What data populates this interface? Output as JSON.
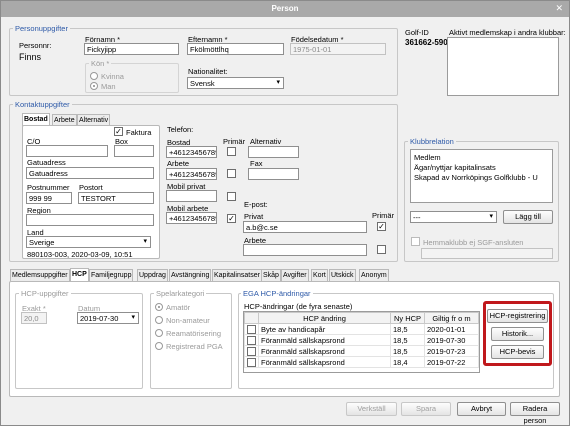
{
  "window": {
    "title": "Person"
  },
  "personuppgifter": {
    "title": "Personuppgifter",
    "personnr_label": "Personnr:",
    "personnr_value": "Finns",
    "fornamn_label": "Förnamn *",
    "fornamn_value": "Fickyjipp",
    "efternamn_label": "Efternamn *",
    "efternamn_value": "Fkölmöttlhq",
    "fodelsedatum_label": "Födelsedatum *",
    "fodelsedatum_value": "1975-01-01",
    "kon_label": "Kön *",
    "kon_options": [
      "Kvinna",
      "Man"
    ],
    "nationalitet_label": "Nationalitet:",
    "nationalitet_value": "Svensk",
    "golf_id_label": "Golf-ID",
    "golf_id_value": "361662-590",
    "aktivt_label": "Aktivt medlemskap i andra klubbar:"
  },
  "kontakt": {
    "title": "Kontaktuppgifter",
    "tabs": [
      "Bostad",
      "Arbete",
      "Alternativ"
    ],
    "faktura_label": "Faktura",
    "co_label": "C/O",
    "box_label": "Box",
    "gatuadress_label": "Gatuadress",
    "gatuadress_value": "Gatuadress",
    "postnummer_label": "Postnummer",
    "postnummer_value": "999 99",
    "postort_label": "Postort",
    "postort_value": "TESTORT",
    "region_label": "Region",
    "land_label": "Land",
    "land_value": "Sverige",
    "footer": "880103-003, 2020-03-09, 10:51",
    "telefon_label": "Telefon:",
    "primar_label": "Primär",
    "alternativ_label": "Alternativ",
    "bostad_label": "Bostad",
    "bostad_value": "+46123456789",
    "arbete_label": "Arbete",
    "arbete_value": "+46123456789",
    "fax_label": "Fax",
    "mobil_privat_label": "Mobil privat",
    "mobil_arbete_label": "Mobil arbete",
    "mobil_arbete_value": "+46123456789",
    "epost_label": "E-post:",
    "privat_label": "Privat",
    "privat_value": "a.b@c.se",
    "epost_primar_label": "Primär",
    "epost_arbete_label": "Arbete"
  },
  "klubbrelation": {
    "title": "Klubbrelation",
    "items": [
      "Medlem",
      "Ägar/nyttjar kapitalinsats",
      "Skapad av Norrköpings Golfklubb - U"
    ],
    "select_value": "---",
    "add_button": "Lägg till",
    "hemmaklubb_label": "Hemmaklubb ej SGF-ansluten"
  },
  "tabs": [
    "Medlemsuppgifter",
    "HCP",
    "Familjegrupp",
    "Uppdrag",
    "Avstängning",
    "Kapitalinsatser",
    "Skåp",
    "Avgifter",
    "Kort",
    "Utskick",
    "Anonym"
  ],
  "hcp_uppgifter": {
    "title": "HCP-uppgifter",
    "exakt_label": "Exakt *",
    "exakt_value": "20,0",
    "datum_label": "Datum",
    "datum_value": "2019-07-30"
  },
  "spelarkategori": {
    "title": "Spelarkategori",
    "options": [
      "Amatör",
      "Non-amateur",
      "Reamatörisering",
      "Registrerad PGA"
    ]
  },
  "ega": {
    "title": "EGA HCP-ändringar",
    "subtitle": "HCP-ändringar (de fyra senaste)",
    "columns": [
      "HCP ändring",
      "Ny HCP",
      "Giltig fr o m"
    ],
    "rows": [
      {
        "change": "Byte av handicapår",
        "hcp": "18,5",
        "date": "2020-01-01"
      },
      {
        "change": "Föranmäld sällskapsrond",
        "hcp": "18,5",
        "date": "2019-07-30"
      },
      {
        "change": "Föranmäld sällskapsrond",
        "hcp": "18,5",
        "date": "2019-07-23"
      },
      {
        "change": "Föranmäld sällskapsrond",
        "hcp": "18,4",
        "date": "2019-07-22"
      }
    ],
    "hcp_registrering": "HCP-registrering",
    "historik": "Historik...",
    "hcp_bevis": "HCP-bevis"
  },
  "footer": {
    "verkstall": "Verkställ",
    "spara": "Spara",
    "avbryt": "Avbryt",
    "radera": "Radera person"
  },
  "colors": {
    "group_title": "#2e5aa8",
    "highlight": "#c0181c",
    "titlebar": "#a9a9a9"
  }
}
